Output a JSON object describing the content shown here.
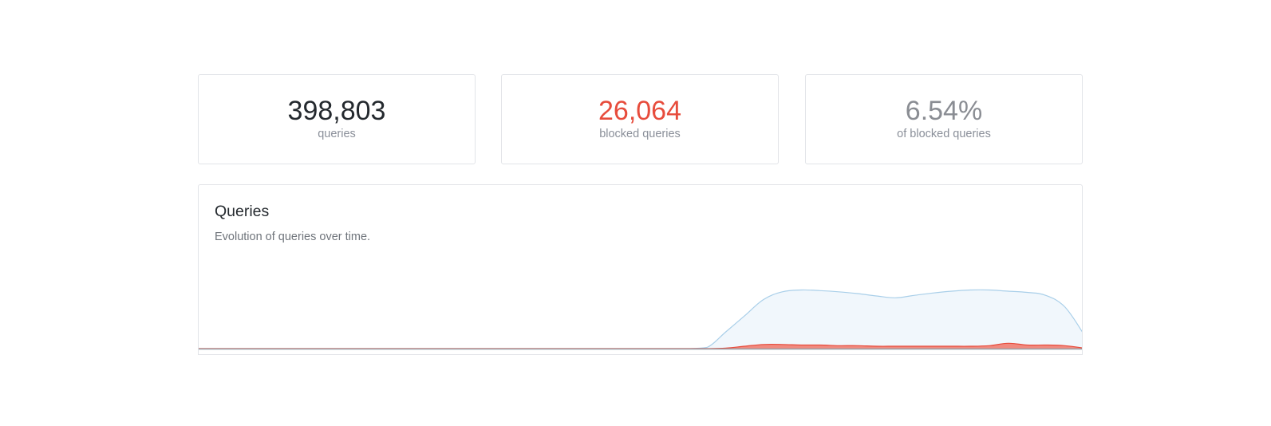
{
  "stats": {
    "total": {
      "value": "398,803",
      "label": "queries"
    },
    "blocked": {
      "value": "26,064",
      "label": "blocked queries"
    },
    "percent": {
      "value": "6.54%",
      "label": "of blocked queries"
    }
  },
  "chart": {
    "title": "Queries",
    "subtitle": "Evolution of queries over time."
  },
  "colors": {
    "total_line": "#a9cfe9",
    "total_fill": "#f1f7fc",
    "blocked_line": "#e74c3c",
    "blocked_fill": "#f08a7f",
    "baseline": "#9aa0a8"
  },
  "chart_data": {
    "type": "area",
    "x": [
      0,
      1,
      2,
      3,
      4,
      5,
      6,
      7,
      8,
      9,
      10,
      11,
      12,
      13,
      14,
      15,
      16,
      17,
      18,
      19,
      20,
      21,
      22,
      23,
      24,
      25,
      26,
      27,
      28,
      29,
      30,
      31,
      32,
      33,
      34,
      35,
      36,
      37,
      38,
      39,
      40,
      41,
      42,
      43,
      44,
      45,
      46,
      47
    ],
    "series": [
      {
        "values": [
          0,
          0,
          0,
          0,
          0,
          0,
          0,
          0,
          0,
          0,
          0,
          0,
          0,
          0,
          0,
          0,
          0,
          0,
          0,
          0,
          0,
          0,
          0,
          0,
          0,
          0,
          0,
          2,
          28,
          55,
          82,
          95,
          98,
          97,
          95,
          92,
          88,
          85,
          89,
          93,
          96,
          98,
          98,
          96,
          94,
          89,
          70,
          25
        ]
      },
      {
        "values": [
          0,
          0,
          0,
          0,
          0,
          0,
          0,
          0,
          0,
          0,
          0,
          0,
          0,
          0,
          0,
          0,
          0,
          0,
          0,
          0,
          0,
          0,
          0,
          0,
          0,
          0,
          0,
          0,
          1,
          4,
          7,
          7,
          6,
          6,
          5,
          5,
          4,
          4,
          4,
          4,
          4,
          4,
          5,
          9,
          6,
          6,
          5,
          1
        ]
      }
    ]
  }
}
